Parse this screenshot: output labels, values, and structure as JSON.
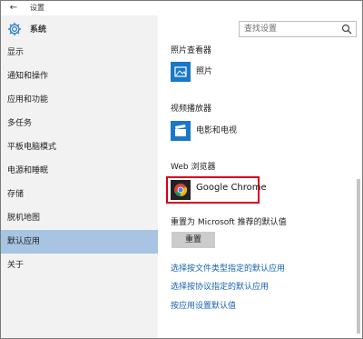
{
  "window": {
    "title": "设置",
    "back_glyph": "←"
  },
  "header": {
    "section_title": "系统",
    "search_placeholder": "查找设置"
  },
  "sidebar": {
    "items": [
      {
        "label": "显示"
      },
      {
        "label": "通知和操作"
      },
      {
        "label": "应用和功能"
      },
      {
        "label": "多任务"
      },
      {
        "label": "平板电脑模式"
      },
      {
        "label": "电源和睡眠"
      },
      {
        "label": "存储"
      },
      {
        "label": "脱机地图"
      },
      {
        "label": "默认应用"
      },
      {
        "label": "关于"
      }
    ],
    "active_index": 8
  },
  "main": {
    "photo_viewer": {
      "heading": "照片查看器",
      "app": "照片"
    },
    "video_player": {
      "heading": "视频播放器",
      "app": "电影和电视"
    },
    "web_browser": {
      "heading": "Web 浏览器",
      "app": "Google Chrome"
    },
    "reset": {
      "heading": "重置为 Microsoft 推荐的默认值",
      "button": "重置"
    },
    "links": [
      "选择按文件类型指定的默认应用",
      "选择按协议指定的默认应用",
      "按应用设置默认值"
    ]
  },
  "colors": {
    "accent": "#1a78c8",
    "active_nav": "#a7c4e3",
    "link": "#1863b1",
    "highlight": "#d9001b"
  }
}
